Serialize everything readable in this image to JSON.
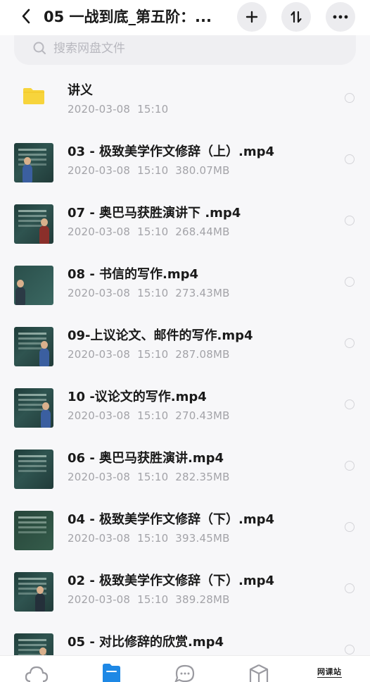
{
  "header": {
    "title": "05 一战到底_第五阶：...",
    "icons": [
      "back-icon",
      "plus-icon",
      "sort-icon",
      "more-icon"
    ]
  },
  "search": {
    "placeholder": "搜索网盘文件"
  },
  "files": [
    {
      "name": "讲义",
      "date": "2020-03-08",
      "time": "15:10",
      "size": "",
      "type": "folder"
    },
    {
      "name": "03 - 极致美学作文修辞（上）.mp4",
      "date": "2020-03-08",
      "time": "15:10",
      "size": "380.07MB",
      "type": "video"
    },
    {
      "name": "07 - 奥巴马获胜演讲下 .mp4",
      "date": "2020-03-08",
      "time": "15:10",
      "size": "268.44MB",
      "type": "video"
    },
    {
      "name": "08 - 书信的写作.mp4",
      "date": "2020-03-08",
      "time": "15:10",
      "size": "273.43MB",
      "type": "video"
    },
    {
      "name": "09-上议论文、邮件的写作.mp4",
      "date": "2020-03-08",
      "time": "15:10",
      "size": "287.08MB",
      "type": "video"
    },
    {
      "name": "10 -议论文的写作.mp4",
      "date": "2020-03-08",
      "time": "15:10",
      "size": "270.43MB",
      "type": "video"
    },
    {
      "name": "06 - 奥巴马获胜演讲.mp4",
      "date": "2020-03-08",
      "time": "15:10",
      "size": "282.35MB",
      "type": "video"
    },
    {
      "name": "04 - 极致美学作文修辞（下）.mp4",
      "date": "2020-03-08",
      "time": "15:10",
      "size": "393.45MB",
      "type": "video"
    },
    {
      "name": "02 - 极致美学作文修辞（下）.mp4",
      "date": "2020-03-08",
      "time": "15:10",
      "size": "389.28MB",
      "type": "video"
    },
    {
      "name": "05 - 对比修辞的欣赏.mp4",
      "date": "",
      "time": "",
      "size": "",
      "type": "video"
    }
  ],
  "bottomnav": {
    "items": [
      "cloud-icon",
      "files-icon",
      "chat-icon",
      "box-icon"
    ],
    "active": "files-icon",
    "watermark": "网课站"
  },
  "colors": {
    "accent": "#1e88e5",
    "folder": "#f7d43c",
    "meta": "#a3a3a8"
  }
}
